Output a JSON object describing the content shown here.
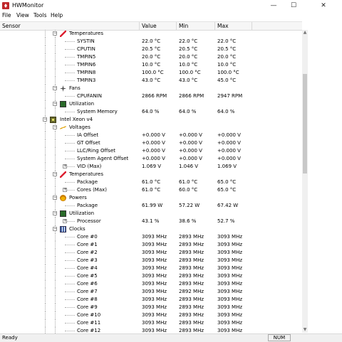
{
  "window": {
    "title": "HWMonitor"
  },
  "menu": [
    "File",
    "View",
    "Tools",
    "Help"
  ],
  "columns": [
    "Sensor",
    "Value",
    "Min",
    "Max"
  ],
  "rows": [
    {
      "level": 2,
      "icon": "ico-temp",
      "exp": "-",
      "label": "Temperatures"
    },
    {
      "level": 3,
      "label": "SYSTIN",
      "value": "22.0 °C",
      "min": "22.0 °C",
      "max": "22.0 °C"
    },
    {
      "level": 3,
      "label": "CPUTIN",
      "value": "20.5 °C",
      "min": "20.5 °C",
      "max": "20.5 °C"
    },
    {
      "level": 3,
      "label": "TMPIN5",
      "value": "20.0 °C",
      "min": "20.0 °C",
      "max": "20.0 °C"
    },
    {
      "level": 3,
      "label": "TMPIN6",
      "value": "10.0 °C",
      "min": "10.0 °C",
      "max": "10.0 °C"
    },
    {
      "level": 3,
      "label": "TMPIN8",
      "value": "100.0 °C",
      "min": "100.0 °C",
      "max": "100.0 °C"
    },
    {
      "level": 3,
      "label": "TMPIN3",
      "value": "43.0 °C",
      "min": "43.0 °C",
      "max": "45.0 °C"
    },
    {
      "level": 2,
      "icon": "ico-fan",
      "exp": "-",
      "label": "Fans"
    },
    {
      "level": 3,
      "label": "CPUFANIN",
      "value": "2866 RPM",
      "min": "2866 RPM",
      "max": "2947 RPM"
    },
    {
      "level": 2,
      "icon": "ico-util",
      "exp": "-",
      "label": "Utilization"
    },
    {
      "level": 3,
      "label": "System Memory",
      "value": "64.0 %",
      "min": "64.0 %",
      "max": "64.0 %"
    },
    {
      "level": 1,
      "icon": "ico-cpu",
      "exp": "-",
      "label": "Intel Xeon v4"
    },
    {
      "level": 2,
      "icon": "ico-volt",
      "exp": "-",
      "label": "Voltages"
    },
    {
      "level": 3,
      "label": "IA Offset",
      "value": "+0.000 V",
      "min": "+0.000 V",
      "max": "+0.000 V"
    },
    {
      "level": 3,
      "label": "GT Offset",
      "value": "+0.000 V",
      "min": "+0.000 V",
      "max": "+0.000 V"
    },
    {
      "level": 3,
      "label": "LLC/Ring Offset",
      "value": "+0.000 V",
      "min": "+0.000 V",
      "max": "+0.000 V"
    },
    {
      "level": 3,
      "label": "System Agent Offset",
      "value": "+0.000 V",
      "min": "+0.000 V",
      "max": "+0.000 V"
    },
    {
      "level": 3,
      "exp": "+",
      "label": "VID (Max)",
      "value": "1.069 V",
      "min": "1.046 V",
      "max": "1.069 V"
    },
    {
      "level": 2,
      "icon": "ico-temp",
      "exp": "-",
      "label": "Temperatures"
    },
    {
      "level": 3,
      "label": "Package",
      "value": "61.0 °C",
      "min": "61.0 °C",
      "max": "65.0 °C"
    },
    {
      "level": 3,
      "exp": "+",
      "label": "Cores (Max)",
      "value": "61.0 °C",
      "min": "60.0 °C",
      "max": "65.0 °C"
    },
    {
      "level": 2,
      "icon": "ico-power",
      "exp": "-",
      "label": "Powers"
    },
    {
      "level": 3,
      "label": "Package",
      "value": "61.99 W",
      "min": "57.22 W",
      "max": "67.42 W"
    },
    {
      "level": 2,
      "icon": "ico-util",
      "exp": "-",
      "label": "Utilization"
    },
    {
      "level": 3,
      "exp": "+",
      "label": "Processor",
      "value": "43.1 %",
      "min": "38.6 %",
      "max": "52.7 %"
    },
    {
      "level": 2,
      "icon": "ico-clock",
      "exp": "-",
      "label": "Clocks"
    },
    {
      "level": 3,
      "label": "Core #0",
      "value": "3093 MHz",
      "min": "2893 MHz",
      "max": "3093 MHz"
    },
    {
      "level": 3,
      "label": "Core #1",
      "value": "3093 MHz",
      "min": "2893 MHz",
      "max": "3093 MHz"
    },
    {
      "level": 3,
      "label": "Core #2",
      "value": "3093 MHz",
      "min": "2893 MHz",
      "max": "3093 MHz"
    },
    {
      "level": 3,
      "label": "Core #3",
      "value": "3093 MHz",
      "min": "2893 MHz",
      "max": "3093 MHz"
    },
    {
      "level": 3,
      "label": "Core #4",
      "value": "3093 MHz",
      "min": "2893 MHz",
      "max": "3093 MHz"
    },
    {
      "level": 3,
      "label": "Core #5",
      "value": "3093 MHz",
      "min": "2893 MHz",
      "max": "3093 MHz"
    },
    {
      "level": 3,
      "label": "Core #6",
      "value": "3093 MHz",
      "min": "2893 MHz",
      "max": "3093 MHz"
    },
    {
      "level": 3,
      "label": "Core #7",
      "value": "3093 MHz",
      "min": "2892 MHz",
      "max": "3093 MHz"
    },
    {
      "level": 3,
      "label": "Core #8",
      "value": "3093 MHz",
      "min": "2893 MHz",
      "max": "3093 MHz"
    },
    {
      "level": 3,
      "label": "Core #9",
      "value": "3093 MHz",
      "min": "2893 MHz",
      "max": "3093 MHz"
    },
    {
      "level": 3,
      "label": "Core #10",
      "value": "3093 MHz",
      "min": "2893 MHz",
      "max": "3093 MHz"
    },
    {
      "level": 3,
      "label": "Core #11",
      "value": "3093 MHz",
      "min": "2893 MHz",
      "max": "3093 MHz"
    },
    {
      "level": 3,
      "label": "Core #12",
      "value": "3093 MHz",
      "min": "2893 MHz",
      "max": "3093 MHz"
    }
  ],
  "status": {
    "text": "Ready",
    "num": "NUM"
  }
}
